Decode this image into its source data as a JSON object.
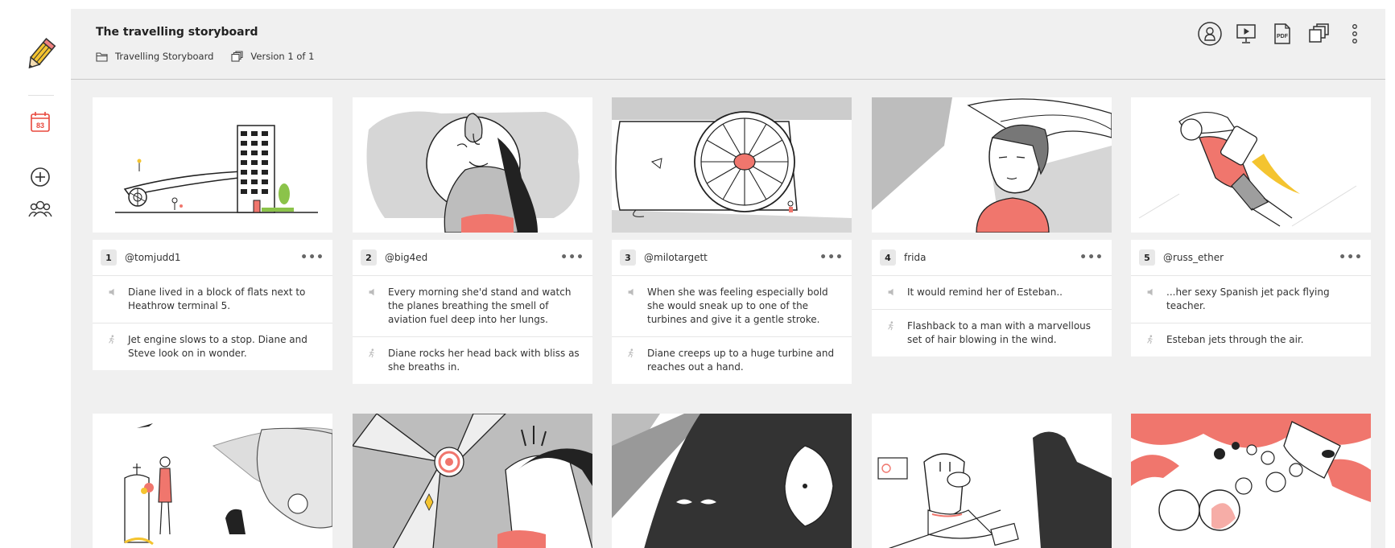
{
  "header": {
    "title": "The travelling storyboard",
    "project": "Travelling Storyboard",
    "version": "Version 1 of 1"
  },
  "sidebar": {
    "calendar_day": "83"
  },
  "icons": {
    "logo": "pencil-icon",
    "calendar": "calendar-icon",
    "add": "add-icon",
    "users": "users-icon",
    "profile": "profile-icon",
    "present": "present-icon",
    "pdf": "pdf-icon",
    "pdf_label": "PDF",
    "duplicate": "duplicate-icon",
    "more": "more-vertical-icon"
  },
  "colors": {
    "accent_red": "#f0766d",
    "calendar_red": "#e8483d"
  },
  "frames": [
    {
      "number": "1",
      "author": "@tomjudd1",
      "dialogue": "Diane lived in a block of flats next to Heathrow terminal 5.",
      "action": "Jet engine slows to a stop. Diane and Steve look on in wonder."
    },
    {
      "number": "2",
      "author": "@big4ed",
      "dialogue": "Every morning she'd stand and watch the planes breathing the smell of aviation fuel deep into her lungs.",
      "action": "Diane rocks her head back with bliss as she breaths in."
    },
    {
      "number": "3",
      "author": "@milotargett",
      "dialogue": "When she was feeling especially bold she would sneak up to one of the turbines and give it a gentle stroke.",
      "action": "Diane creeps up to a huge turbine and reaches out a hand."
    },
    {
      "number": "4",
      "author": "frida",
      "dialogue": "It would remind her of Esteban..",
      "action": "Flashback to a man with a marvellous set of hair blowing in the wind."
    },
    {
      "number": "5",
      "author": "@russ_ether",
      "dialogue": "...her sexy Spanish jet pack flying teacher.",
      "action": "Esteban jets through the air."
    }
  ],
  "more_label": "•••"
}
